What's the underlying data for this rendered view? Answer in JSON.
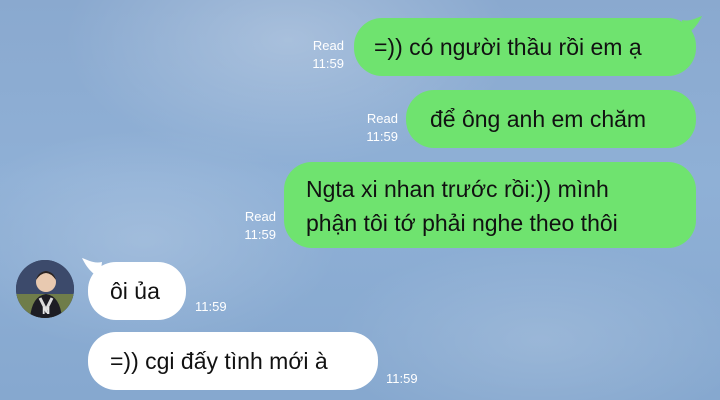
{
  "colors": {
    "outgoing_bubble": "#6fe36f",
    "incoming_bubble": "#ffffff",
    "background": "#8aa9cf"
  },
  "messages": [
    {
      "direction": "out",
      "text": "=)) có người thầu rồi em ạ",
      "status": "Read",
      "time": "11:59"
    },
    {
      "direction": "out",
      "text": "để ông anh em chăm",
      "status": "Read",
      "time": "11:59"
    },
    {
      "direction": "out",
      "line1": "Ngta xi nhan trước rồi:)) mình",
      "line2": "phận tôi tớ phải nghe theo thôi",
      "status": "Read",
      "time": "11:59"
    },
    {
      "direction": "in",
      "text": "ôi ủa",
      "time": "11:59"
    },
    {
      "direction": "in",
      "text": "=)) cgi đấy tình mới à",
      "time": "11:59"
    }
  ],
  "contact": {
    "avatar_icon": "contact-avatar"
  }
}
